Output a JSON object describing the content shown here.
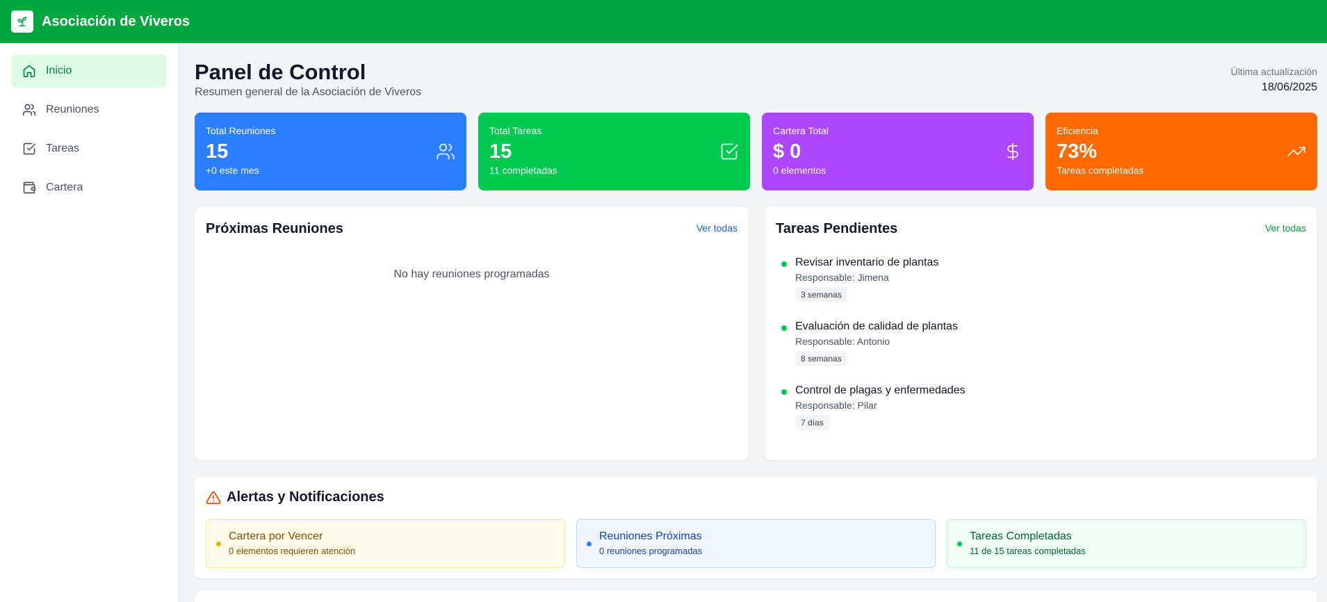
{
  "app": {
    "title": "Asociación de Viveros"
  },
  "sidebar": {
    "items": [
      {
        "label": "Inicio",
        "icon": "home-icon",
        "active": true
      },
      {
        "label": "Reuniones",
        "icon": "users-icon",
        "active": false
      },
      {
        "label": "Tareas",
        "icon": "checkbox-icon",
        "active": false
      },
      {
        "label": "Cartera",
        "icon": "wallet-icon",
        "active": false
      }
    ]
  },
  "header": {
    "title": "Panel de Control",
    "subtitle": "Resumen general de la Asociación de Viveros",
    "updated_label": "Última actualización",
    "updated_date": "18/06/2025"
  },
  "stats": [
    {
      "label": "Total Reuniones",
      "value": "15",
      "sub": "+0 este mes",
      "color": "#2b7fff",
      "icon": "users-icon"
    },
    {
      "label": "Total Tareas",
      "value": "15",
      "sub": "11 completadas",
      "color": "#00c950",
      "icon": "checkbox-icon"
    },
    {
      "label": "Cartera Total",
      "value": "$ 0",
      "sub": "0 elementos",
      "color": "#ad46ff",
      "icon": "dollar-icon"
    },
    {
      "label": "Eficiencia",
      "value": "73%",
      "sub": "Tareas completadas",
      "color": "#ff6900",
      "icon": "trending-up-icon"
    }
  ],
  "meetings": {
    "title": "Próximas Reuniones",
    "link": "Ver todas",
    "link_color": "#155dfc",
    "empty": "No hay reuniones programadas"
  },
  "tasks": {
    "title": "Tareas Pendientes",
    "link": "Ver todas",
    "link_color": "#00a63e",
    "items": [
      {
        "title": "Revisar inventario de plantas",
        "responsible": "Responsable: Jimena",
        "tag": "3 semanas"
      },
      {
        "title": "Evaluación de calidad de plantas",
        "responsible": "Responsable: Antonio",
        "tag": "8 semanas"
      },
      {
        "title": "Control de plagas y enfermedades",
        "responsible": "Responsable: Pilar",
        "tag": "7 días"
      }
    ]
  },
  "alerts": {
    "title": "Alertas y Notificaciones",
    "items": [
      {
        "title": "Cartera por Vencer",
        "desc": "0 elementos requieren atención",
        "bg": "#fefce8",
        "border": "#fde68a",
        "text": "#894b00",
        "dot": "#f0b100"
      },
      {
        "title": "Reuniones Próximas",
        "desc": "0 reuniones programadas",
        "bg": "#eff6ff",
        "border": "#bedbff",
        "text": "#193cb8",
        "dot": "#2b7fff"
      },
      {
        "title": "Tareas Completadas",
        "desc": "11 de 15 tareas completadas",
        "bg": "#f0fdf4",
        "border": "#b9f8cf",
        "text": "#016630",
        "dot": "#00c950"
      }
    ]
  }
}
